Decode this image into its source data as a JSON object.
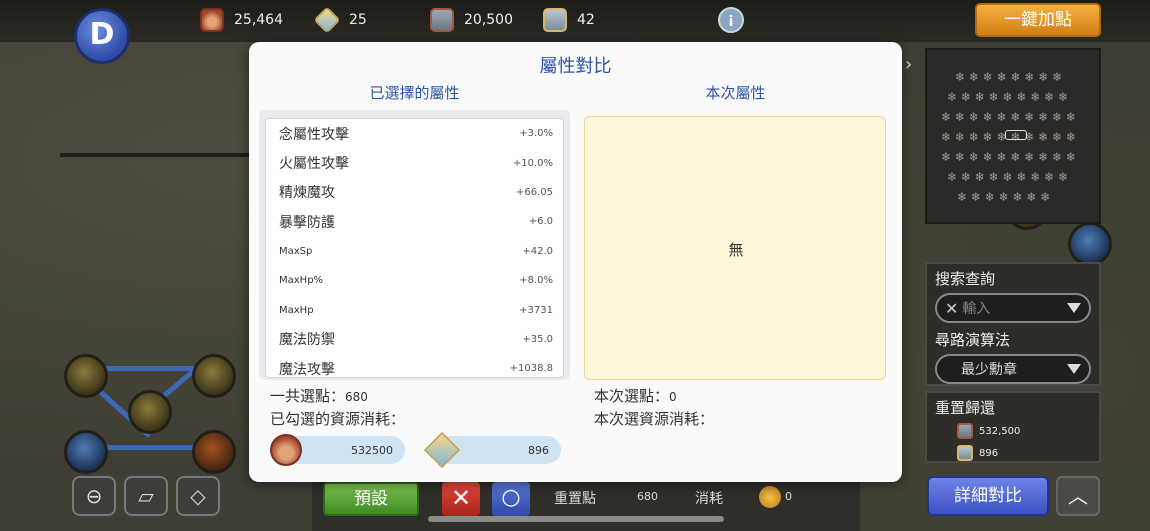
{
  "top_bar": {
    "resources": [
      {
        "icon": "medal-icon",
        "value": "25,464"
      },
      {
        "icon": "gem-icon",
        "value": "25"
      },
      {
        "icon": "medal-bag-icon",
        "value": "20,500"
      },
      {
        "icon": "gem-bag-icon",
        "value": "42"
      }
    ],
    "info_icon": "i",
    "auto_assign_label": "一鍵加點",
    "back_icon": "D"
  },
  "modal": {
    "title": "屬性對比",
    "selected_header": "已選擇的屬性",
    "current_header": "本次屬性",
    "attributes": [
      {
        "name": "念屬性攻擊",
        "value": "+3.0%"
      },
      {
        "name": "火屬性攻擊",
        "value": "+10.0%"
      },
      {
        "name": "精煉魔攻",
        "value": "+66.05"
      },
      {
        "name": "暴擊防護",
        "value": "+6.0"
      },
      {
        "name": "MaxSp",
        "value": "+42.0"
      },
      {
        "name": "MaxHp%",
        "value": "+8.0%"
      },
      {
        "name": "MaxHp",
        "value": "+3731"
      },
      {
        "name": "魔法防禦",
        "value": "+35.0"
      },
      {
        "name": "魔法攻擊",
        "value": "+1038.8"
      }
    ],
    "current_none": "無",
    "total_points_label": "一共選點：",
    "total_points_value": "680",
    "checked_cost_label": "已勾選的資源消耗：",
    "current_points_label": "本次選點：",
    "current_points_value": "0",
    "current_cost_label": "本次選資源消耗：",
    "cost_medal_value": "532500",
    "cost_gem_value": "896"
  },
  "side_panel": {
    "search_label": "搜索查詢",
    "search_placeholder": "輸入",
    "algorithm_label": "尋路演算法",
    "algorithm_value": "最少勳章",
    "reset_label": "重置歸還",
    "reset_medal_value": "532,500",
    "reset_gem_value": "896",
    "detail_button": "詳細對比",
    "up_icon": "︿"
  },
  "bottom_bar": {
    "preset_label": "預設",
    "cancel_icon": "✕",
    "confirm_icon": "○",
    "reset_points_label": "重置點",
    "reset_points_value": "680",
    "consume_label": "消耗",
    "consume_value": "0"
  },
  "tools": [
    "zoom-out-icon",
    "eraser-icon",
    "route-icon"
  ],
  "colors": {
    "accent_blue": "#2d55a8",
    "auto_button": "#e59a2a",
    "preset_green": "#5aa83a",
    "detail_blue": "#4f66d6"
  }
}
